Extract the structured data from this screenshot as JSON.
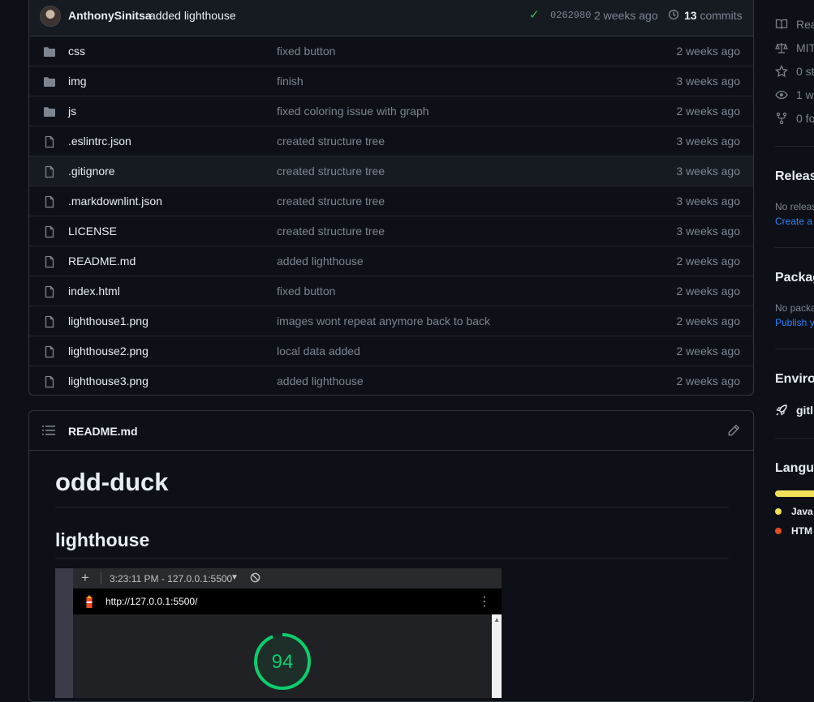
{
  "commit": {
    "author": "AnthonySinitsa",
    "message": "added lighthouse",
    "sha": "0262980",
    "age": "2 weeks ago",
    "commit_count": "13",
    "commits_label": "commits"
  },
  "files": [
    {
      "name": "css",
      "type": "folder",
      "message": "fixed button",
      "age": "2 weeks ago"
    },
    {
      "name": "img",
      "type": "folder",
      "message": "finish",
      "age": "3 weeks ago"
    },
    {
      "name": "js",
      "type": "folder",
      "message": "fixed coloring issue with graph",
      "age": "2 weeks ago"
    },
    {
      "name": ".eslintrc.json",
      "type": "file",
      "message": "created structure tree",
      "age": "3 weeks ago"
    },
    {
      "name": ".gitignore",
      "type": "file",
      "message": "created structure tree",
      "age": "3 weeks ago"
    },
    {
      "name": ".markdownlint.json",
      "type": "file",
      "message": "created structure tree",
      "age": "3 weeks ago"
    },
    {
      "name": "LICENSE",
      "type": "file",
      "message": "created structure tree",
      "age": "3 weeks ago"
    },
    {
      "name": "README.md",
      "type": "file",
      "message": "added lighthouse",
      "age": "2 weeks ago"
    },
    {
      "name": "index.html",
      "type": "file",
      "message": "fixed button",
      "age": "2 weeks ago"
    },
    {
      "name": "lighthouse1.png",
      "type": "file",
      "message": "images wont repeat anymore back to back",
      "age": "2 weeks ago"
    },
    {
      "name": "lighthouse2.png",
      "type": "file",
      "message": "local data added",
      "age": "2 weeks ago"
    },
    {
      "name": "lighthouse3.png",
      "type": "file",
      "message": "added lighthouse",
      "age": "2 weeks ago"
    }
  ],
  "readme": {
    "header": "README.md",
    "h1": "odd-duck",
    "h2": "lighthouse",
    "screenshot": {
      "run_time": "3:23:11 PM - 127.0.0.1:5500",
      "url": "http://127.0.0.1:5500/",
      "score": "94",
      "score_fraction": 0.94
    }
  },
  "sidebar": {
    "about": [
      {
        "icon": "book-icon",
        "text": "Rea"
      },
      {
        "icon": "law-icon",
        "text": "MIT"
      },
      {
        "icon": "star-icon",
        "text": "0 st"
      },
      {
        "icon": "eye-icon",
        "text": "1 w"
      },
      {
        "icon": "fork-icon",
        "text": "0 fo"
      }
    ],
    "releases_title": "Release",
    "releases_none": "No releas",
    "releases_link": "Create a",
    "packages_title": "Packag",
    "packages_none": "No packa",
    "packages_link": "Publish y",
    "environments_title": "Environ",
    "environment_item": "gitl",
    "languages_title": "Langua",
    "languages": [
      {
        "name": "Java",
        "color": "#f1e05a"
      },
      {
        "name": "HTM",
        "color": "#e34c26"
      }
    ]
  }
}
